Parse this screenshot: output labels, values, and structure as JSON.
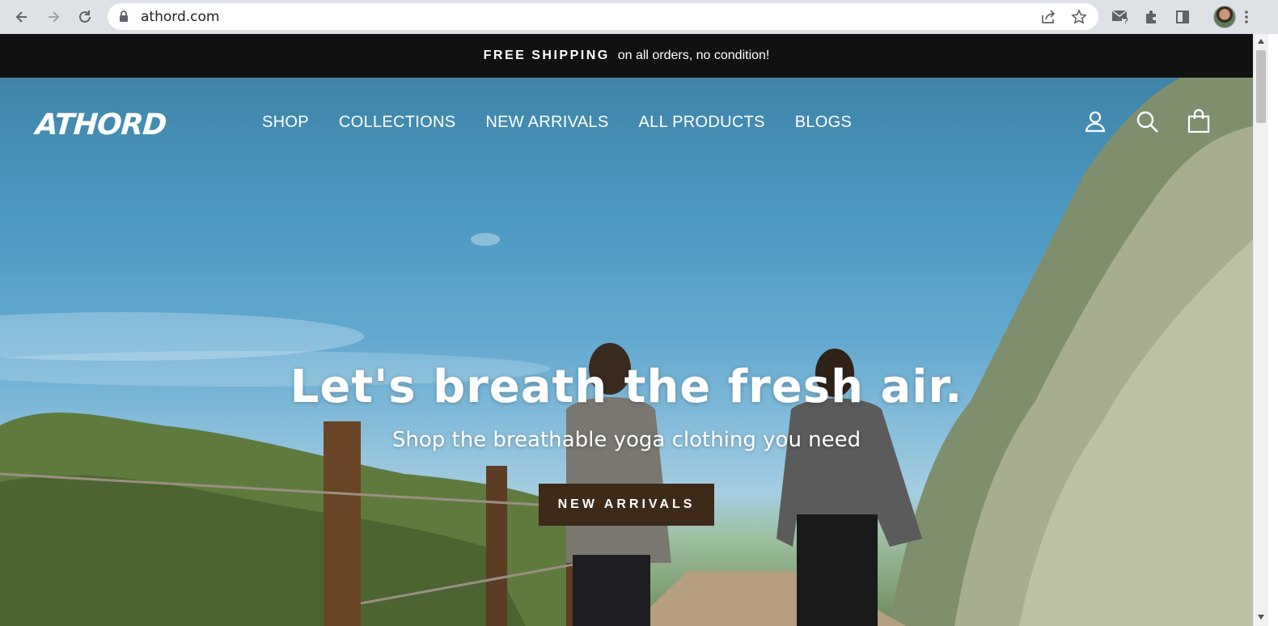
{
  "browser": {
    "url": "athord.com",
    "icons": [
      "back-icon",
      "forward-icon",
      "reload-icon",
      "lock-icon",
      "share-icon",
      "bookmark-star-icon",
      "mail-extension-icon",
      "puzzle-extensions-icon",
      "side-panel-icon",
      "profile-avatar",
      "more-menu-icon"
    ],
    "extension_badge": "?"
  },
  "announcement": {
    "strong": "FREE SHIPPING",
    "light": "on all orders, no condition!"
  },
  "header": {
    "logo": "ATHORD",
    "nav": [
      "SHOP",
      "COLLECTIONS",
      "NEW ARRIVALS",
      "ALL PRODUCTS",
      "BLOGS"
    ],
    "icons": [
      "account-icon",
      "search-icon",
      "cart-icon"
    ]
  },
  "hero": {
    "title": "Let's breath the fresh air.",
    "subtitle": "Shop the breathable yoga clothing you need",
    "button": "NEW ARRIVALS"
  },
  "colors": {
    "announcement_bg": "#111111",
    "button_bg": "#3d2a18",
    "sky": "#4c99c2"
  }
}
